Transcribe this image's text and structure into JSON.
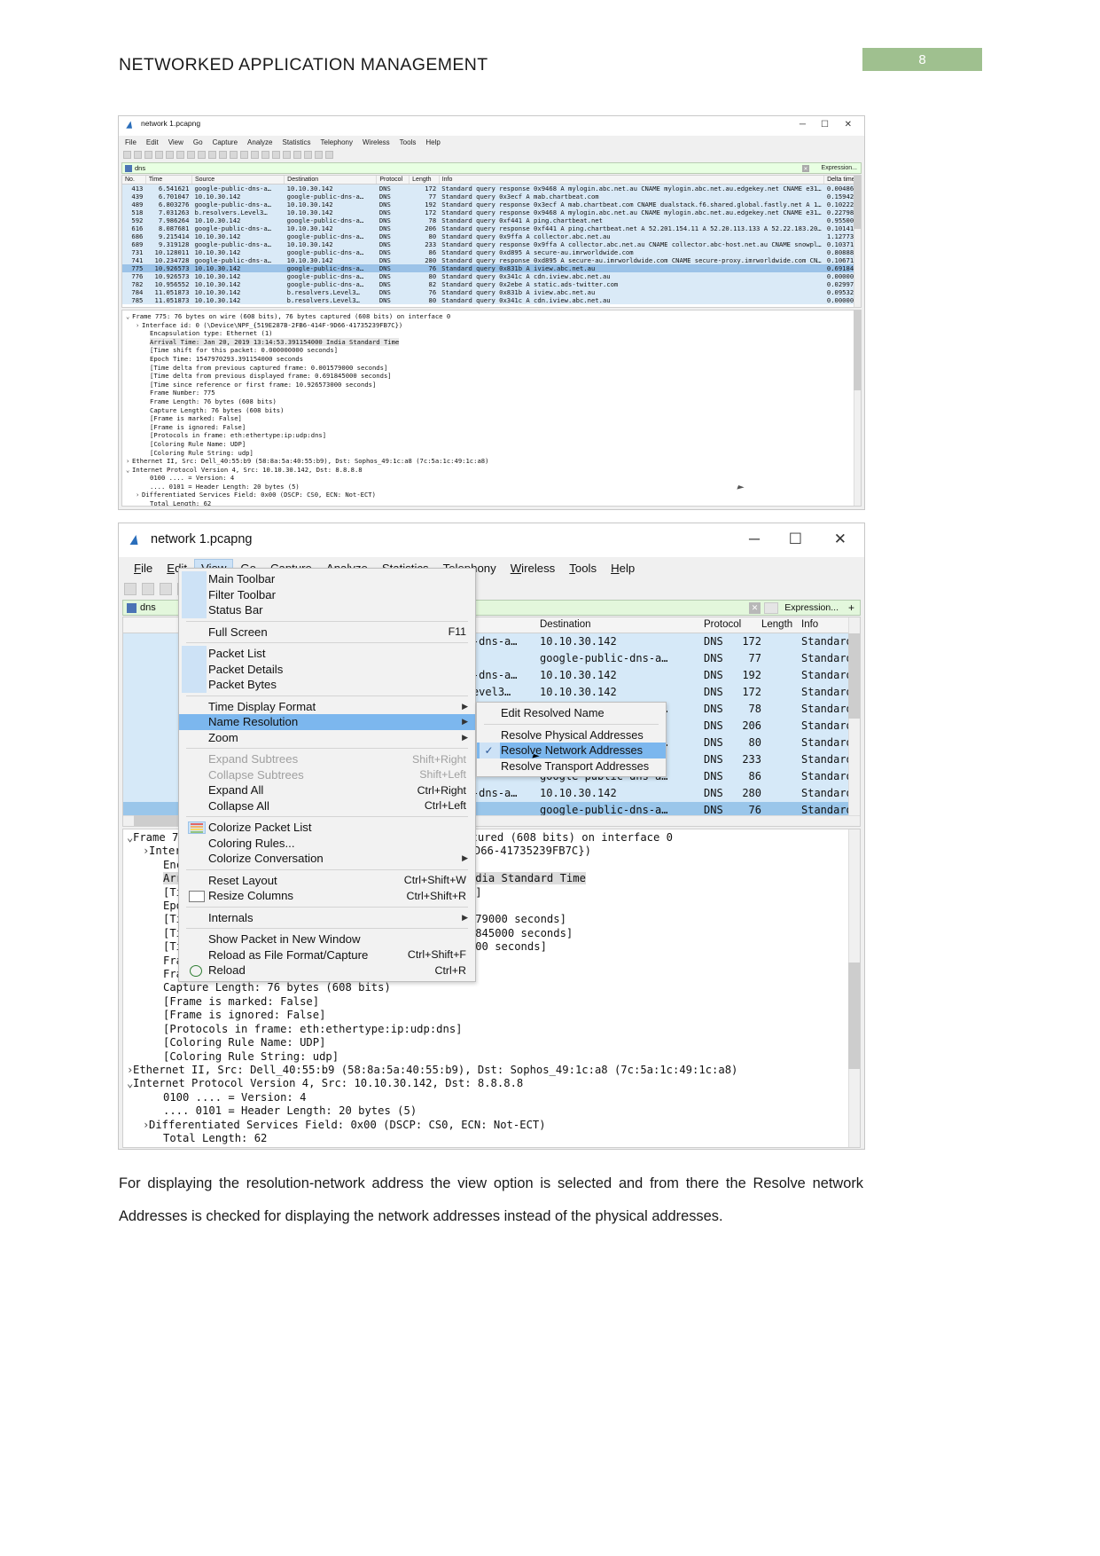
{
  "document": {
    "header_title": "NETWORKED APPLICATION MANAGEMENT",
    "page_number": "8",
    "paragraph": "For displaying the resolution-network address the view option is selected and from there the Resolve network Addresses is checked for displaying the network addresses instead of the physical addresses."
  },
  "window": {
    "title": "network 1.pcapng",
    "minimize": "─",
    "maximize": "☐",
    "close": "✕",
    "menus": [
      "File",
      "Edit",
      "View",
      "Go",
      "Capture",
      "Analyze",
      "Statistics",
      "Telephony",
      "Wireless",
      "Tools",
      "Help"
    ],
    "filter": {
      "value": "dns",
      "expression_label": "Expression...",
      "clear": "✕",
      "plus": "+"
    }
  },
  "packet_list": {
    "columns": [
      "No.",
      "Time",
      "Source",
      "Destination",
      "Protocol",
      "Length",
      "Info",
      "Delta time"
    ],
    "rows": [
      {
        "no": "413",
        "time": "6.541621",
        "source": "google-public-dns-a…",
        "destination": "10.10.30.142",
        "protocol": "DNS",
        "length": "172",
        "info": "Standard query response 0x9468 A mylogin.abc.net.au CNAME mylogin.abc.net.au.edgekey.net CNAME e31…",
        "delta": "0.004863",
        "selected": false
      },
      {
        "no": "439",
        "time": "6.701047",
        "source": "10.10.30.142",
        "destination": "google-public-dns-a…",
        "protocol": "DNS",
        "length": "77",
        "info": "Standard query 0x3ecf A mab.chartbeat.com",
        "delta": "0.159426",
        "selected": false
      },
      {
        "no": "489",
        "time": "6.803276",
        "source": "google-public-dns-a…",
        "destination": "10.10.30.142",
        "protocol": "DNS",
        "length": "192",
        "info": "Standard query response 0x3ecf A mab.chartbeat.com CNAME dualstack.f6.shared.global.fastly.net A 1…",
        "delta": "0.102229",
        "selected": false
      },
      {
        "no": "518",
        "time": "7.031263",
        "source": "b.resolvers.Level3…",
        "destination": "10.10.30.142",
        "protocol": "DNS",
        "length": "172",
        "info": "Standard query response 0x9468 A mylogin.abc.net.au CNAME mylogin.abc.net.au.edgekey.net CNAME e31…",
        "delta": "0.227987",
        "selected": false
      },
      {
        "no": "592",
        "time": "7.986264",
        "source": "10.10.30.142",
        "destination": "google-public-dns-a…",
        "protocol": "DNS",
        "length": "78",
        "info": "Standard query 0xf441 A ping.chartbeat.net",
        "delta": "0.955001",
        "selected": false
      },
      {
        "no": "616",
        "time": "8.087681",
        "source": "google-public-dns-a…",
        "destination": "10.10.30.142",
        "protocol": "DNS",
        "length": "206",
        "info": "Standard query response 0xf441 A ping.chartbeat.net A 52.201.154.11 A 52.20.113.133 A 52.22.183.20…",
        "delta": "0.101417",
        "selected": false
      },
      {
        "no": "686",
        "time": "9.215414",
        "source": "10.10.30.142",
        "destination": "google-public-dns-a…",
        "protocol": "DNS",
        "length": "80",
        "info": "Standard query 0x9ffa A collector.abc.net.au",
        "delta": "1.127733",
        "selected": false
      },
      {
        "no": "689",
        "time": "9.319128",
        "source": "google-public-dns-a…",
        "destination": "10.10.30.142",
        "protocol": "DNS",
        "length": "233",
        "info": "Standard query response 0x9ffa A collector.abc.net.au CNAME collector.abc-host.net.au CNAME snowpl…",
        "delta": "0.103714",
        "selected": false
      },
      {
        "no": "731",
        "time": "10.128011",
        "source": "10.10.30.142",
        "destination": "google-public-dns-a…",
        "protocol": "DNS",
        "length": "86",
        "info": "Standard query 0xd895 A secure-au.imrworldwide.com",
        "delta": "0.808883",
        "selected": false
      },
      {
        "no": "741",
        "time": "10.234728",
        "source": "google-public-dns-a…",
        "destination": "10.10.30.142",
        "protocol": "DNS",
        "length": "280",
        "info": "Standard query response 0xd895 A secure-au.imrworldwide.com CNAME secure-proxy.imrworldwide.com CN…",
        "delta": "0.106717",
        "selected": false
      },
      {
        "no": "775",
        "time": "10.926573",
        "source": "10.10.30.142",
        "destination": "google-public-dns-a…",
        "protocol": "DNS",
        "length": "76",
        "info": "Standard query 0x831b A iview.abc.net.au",
        "delta": "0.691845",
        "selected": true
      },
      {
        "no": "776",
        "time": "10.926573",
        "source": "10.10.30.142",
        "destination": "google-public-dns-a…",
        "protocol": "DNS",
        "length": "80",
        "info": "Standard query 0x341c A cdn.iview.abc.net.au",
        "delta": "0.000000",
        "selected": false
      },
      {
        "no": "782",
        "time": "10.956552",
        "source": "10.10.30.142",
        "destination": "google-public-dns-a…",
        "protocol": "DNS",
        "length": "82",
        "info": "Standard query 0x2ebe A static.ads-twitter.com",
        "delta": "0.029979",
        "selected": false
      },
      {
        "no": "784",
        "time": "11.051873",
        "source": "10.10.30.142",
        "destination": "b.resolvers.Level3…",
        "protocol": "DNS",
        "length": "76",
        "info": "Standard query 0x831b A iview.abc.net.au",
        "delta": "0.095321",
        "selected": false
      },
      {
        "no": "785",
        "time": "11.051873",
        "source": "10.10.30.142",
        "destination": "b.resolvers.Level3…",
        "protocol": "DNS",
        "length": "80",
        "info": "Standard query 0x341c A cdn.iview.abc.net.au",
        "delta": "0.000000",
        "selected": false
      }
    ]
  },
  "packet_details": {
    "lines": [
      {
        "text": "Frame 775: 76 bytes on wire (608 bits), 76 bytes captured (608 bits) on interface 0",
        "indent": 0,
        "toggle": "v",
        "highlight": false
      },
      {
        "text": "Interface id: 0 (\\Device\\NPF_{519E287B-2FB6-414F-9D66-41735239FB7C})",
        "indent": 1,
        "toggle": ">",
        "highlight": false
      },
      {
        "text": "Encapsulation type: Ethernet (1)",
        "indent": 2,
        "toggle": "",
        "highlight": false
      },
      {
        "text": "Arrival Time: Jan 20, 2019 13:14:53.391154000 India Standard Time",
        "indent": 2,
        "toggle": "",
        "highlight": true
      },
      {
        "text": "[Time shift for this packet: 0.000000000 seconds]",
        "indent": 2,
        "toggle": "",
        "highlight": false
      },
      {
        "text": "Epoch Time: 1547970293.391154000 seconds",
        "indent": 2,
        "toggle": "",
        "highlight": false
      },
      {
        "text": "[Time delta from previous captured frame: 0.001579000 seconds]",
        "indent": 2,
        "toggle": "",
        "highlight": false
      },
      {
        "text": "[Time delta from previous displayed frame: 0.691845000 seconds]",
        "indent": 2,
        "toggle": "",
        "highlight": false
      },
      {
        "text": "[Time since reference or first frame: 10.926573000 seconds]",
        "indent": 2,
        "toggle": "",
        "highlight": false
      },
      {
        "text": "Frame Number: 775",
        "indent": 2,
        "toggle": "",
        "highlight": false
      },
      {
        "text": "Frame Length: 76 bytes (608 bits)",
        "indent": 2,
        "toggle": "",
        "highlight": false
      },
      {
        "text": "Capture Length: 76 bytes (608 bits)",
        "indent": 2,
        "toggle": "",
        "highlight": false
      },
      {
        "text": "[Frame is marked: False]",
        "indent": 2,
        "toggle": "",
        "highlight": false
      },
      {
        "text": "[Frame is ignored: False]",
        "indent": 2,
        "toggle": "",
        "highlight": false
      },
      {
        "text": "[Protocols in frame: eth:ethertype:ip:udp:dns]",
        "indent": 2,
        "toggle": "",
        "highlight": false
      },
      {
        "text": "[Coloring Rule Name: UDP]",
        "indent": 2,
        "toggle": "",
        "highlight": false
      },
      {
        "text": "[Coloring Rule String: udp]",
        "indent": 2,
        "toggle": "",
        "highlight": false
      },
      {
        "text": "Ethernet II, Src: Dell_40:55:b9 (58:8a:5a:40:55:b9), Dst: Sophos_49:1c:a8 (7c:5a:1c:49:1c:a8)",
        "indent": 0,
        "toggle": ">",
        "highlight": false
      },
      {
        "text": "Internet Protocol Version 4, Src: 10.10.30.142, Dst: 8.8.8.8",
        "indent": 0,
        "toggle": "v",
        "highlight": false
      },
      {
        "text": "0100 .... = Version: 4",
        "indent": 2,
        "toggle": "",
        "highlight": false
      },
      {
        "text": ".... 0101 = Header Length: 20 bytes (5)",
        "indent": 2,
        "toggle": "",
        "highlight": false
      },
      {
        "text": "Differentiated Services Field: 0x00 (DSCP: CS0, ECN: Not-ECT)",
        "indent": 1,
        "toggle": ">",
        "highlight": false
      },
      {
        "text": "Total Length: 62",
        "indent": 2,
        "toggle": "",
        "highlight": false
      }
    ]
  },
  "view_menu": {
    "items": [
      {
        "label": "Main Toolbar",
        "accel": "",
        "checked": true,
        "disabled": false,
        "highlighted": false,
        "submenu": false,
        "sep_after": false,
        "icon": ""
      },
      {
        "label": "Filter Toolbar",
        "accel": "",
        "checked": true,
        "disabled": false,
        "highlighted": false,
        "submenu": false,
        "sep_after": false,
        "icon": ""
      },
      {
        "label": "Status Bar",
        "accel": "",
        "checked": true,
        "disabled": false,
        "highlighted": false,
        "submenu": false,
        "sep_after": true,
        "icon": ""
      },
      {
        "label": "Full Screen",
        "accel": "F11",
        "checked": false,
        "disabled": false,
        "highlighted": false,
        "submenu": false,
        "sep_after": true,
        "icon": ""
      },
      {
        "label": "Packet List",
        "accel": "",
        "checked": true,
        "disabled": false,
        "highlighted": false,
        "submenu": false,
        "sep_after": false,
        "icon": ""
      },
      {
        "label": "Packet Details",
        "accel": "",
        "checked": true,
        "disabled": false,
        "highlighted": false,
        "submenu": false,
        "sep_after": false,
        "icon": ""
      },
      {
        "label": "Packet Bytes",
        "accel": "",
        "checked": true,
        "disabled": false,
        "highlighted": false,
        "submenu": false,
        "sep_after": true,
        "icon": ""
      },
      {
        "label": "Time Display Format",
        "accel": "",
        "checked": false,
        "disabled": false,
        "highlighted": false,
        "submenu": true,
        "sep_after": false,
        "icon": ""
      },
      {
        "label": "Name Resolution",
        "accel": "",
        "checked": false,
        "disabled": false,
        "highlighted": true,
        "submenu": true,
        "sep_after": false,
        "icon": ""
      },
      {
        "label": "Zoom",
        "accel": "",
        "checked": false,
        "disabled": false,
        "highlighted": false,
        "submenu": true,
        "sep_after": true,
        "icon": ""
      },
      {
        "label": "Expand Subtrees",
        "accel": "Shift+Right",
        "checked": false,
        "disabled": true,
        "highlighted": false,
        "submenu": false,
        "sep_after": false,
        "icon": ""
      },
      {
        "label": "Collapse Subtrees",
        "accel": "Shift+Left",
        "checked": false,
        "disabled": true,
        "highlighted": false,
        "submenu": false,
        "sep_after": false,
        "icon": ""
      },
      {
        "label": "Expand All",
        "accel": "Ctrl+Right",
        "checked": false,
        "disabled": false,
        "highlighted": false,
        "submenu": false,
        "sep_after": false,
        "icon": ""
      },
      {
        "label": "Collapse All",
        "accel": "Ctrl+Left",
        "checked": false,
        "disabled": false,
        "highlighted": false,
        "submenu": false,
        "sep_after": true,
        "icon": ""
      },
      {
        "label": "Colorize Packet List",
        "accel": "",
        "checked": false,
        "disabled": false,
        "highlighted": false,
        "submenu": false,
        "sep_after": false,
        "icon": "colorize-icon"
      },
      {
        "label": "Coloring Rules...",
        "accel": "",
        "checked": false,
        "disabled": false,
        "highlighted": false,
        "submenu": false,
        "sep_after": false,
        "icon": ""
      },
      {
        "label": "Colorize Conversation",
        "accel": "",
        "checked": false,
        "disabled": false,
        "highlighted": false,
        "submenu": true,
        "sep_after": true,
        "icon": ""
      },
      {
        "label": "Reset Layout",
        "accel": "Ctrl+Shift+W",
        "checked": false,
        "disabled": false,
        "highlighted": false,
        "submenu": false,
        "sep_after": false,
        "icon": ""
      },
      {
        "label": "Resize Columns",
        "accel": "Ctrl+Shift+R",
        "checked": false,
        "disabled": false,
        "highlighted": false,
        "submenu": false,
        "sep_after": true,
        "icon": "resize-columns-icon"
      },
      {
        "label": "Internals",
        "accel": "",
        "checked": false,
        "disabled": false,
        "highlighted": false,
        "submenu": true,
        "sep_after": true,
        "icon": ""
      },
      {
        "label": "Show Packet in New Window",
        "accel": "",
        "checked": false,
        "disabled": false,
        "highlighted": false,
        "submenu": false,
        "sep_after": false,
        "icon": ""
      },
      {
        "label": "Reload as File Format/Capture",
        "accel": "Ctrl+Shift+F",
        "checked": false,
        "disabled": false,
        "highlighted": false,
        "submenu": false,
        "sep_after": false,
        "icon": ""
      },
      {
        "label": "Reload",
        "accel": "Ctrl+R",
        "checked": false,
        "disabled": false,
        "highlighted": false,
        "submenu": false,
        "sep_after": false,
        "icon": "reload-icon"
      }
    ]
  },
  "name_resolution_submenu": {
    "items": [
      {
        "label": "Edit Resolved Name",
        "checked": false,
        "highlighted": false,
        "sep_after": true
      },
      {
        "label": "Resolve Physical Addresses",
        "checked": false,
        "highlighted": false,
        "sep_after": false
      },
      {
        "label": "Resolve Network Addresses",
        "checked": true,
        "highlighted": true,
        "sep_after": false
      },
      {
        "label": "Resolve Transport Addresses",
        "checked": false,
        "highlighted": false,
        "sep_after": false
      }
    ]
  },
  "colors": {
    "accent": "#cde2f6",
    "highlight": "#7cb7ee",
    "filter_bar": "#e3f7dc",
    "row": "#d6e9f8",
    "row_selected": "#9ac6ea",
    "page_badge": "#9fc08f"
  }
}
